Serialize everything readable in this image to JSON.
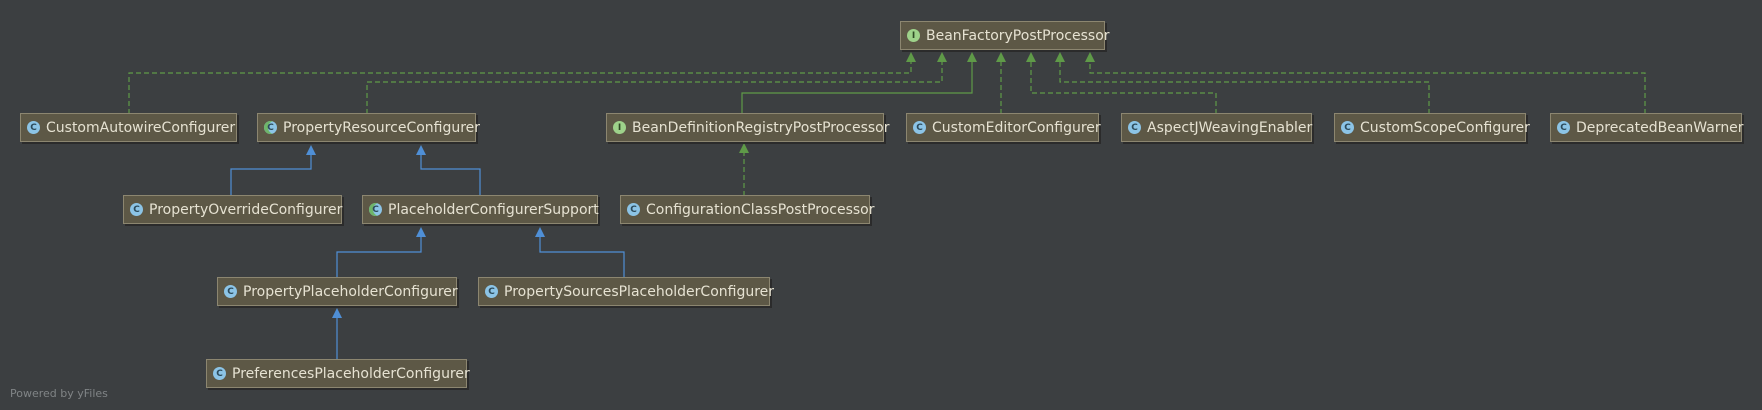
{
  "footer": "Powered by yFiles",
  "nodes": {
    "bfpp": {
      "label": "BeanFactoryPostProcessor",
      "kind": "I"
    },
    "autowire": {
      "label": "CustomAutowireConfigurer",
      "kind": "C"
    },
    "prc": {
      "label": "PropertyResourceConfigurer",
      "kind": "C"
    },
    "bdrpp": {
      "label": "BeanDefinitionRegistryPostProcessor",
      "kind": "I"
    },
    "editor": {
      "label": "CustomEditorConfigurer",
      "kind": "C"
    },
    "aspectj": {
      "label": "AspectJWeavingEnabler",
      "kind": "C"
    },
    "scope": {
      "label": "CustomScopeConfigurer",
      "kind": "C"
    },
    "deprecated": {
      "label": "DeprecatedBeanWarner",
      "kind": "C"
    },
    "override": {
      "label": "PropertyOverrideConfigurer",
      "kind": "C"
    },
    "pcs": {
      "label": "PlaceholderConfigurerSupport",
      "kind": "C"
    },
    "ccpp": {
      "label": "ConfigurationClassPostProcessor",
      "kind": "C"
    },
    "ppc": {
      "label": "PropertyPlaceholderConfigurer",
      "kind": "C"
    },
    "pspc": {
      "label": "PropertySourcesPlaceholderConfigurer",
      "kind": "C"
    },
    "prefs": {
      "label": "PreferencesPlaceholderConfigurer",
      "kind": "C"
    }
  },
  "colors": {
    "implements_edge": "#5f9a48",
    "extends_edge": "#4f8fd6",
    "background": "#3c3f41"
  }
}
